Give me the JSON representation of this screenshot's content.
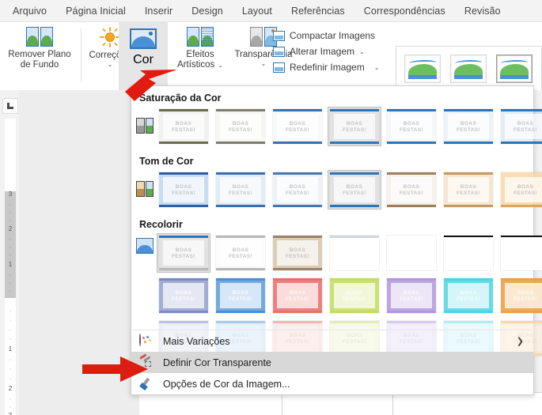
{
  "ribbon": {
    "tabs": [
      {
        "label": "Arquivo"
      },
      {
        "label": "Página Inicial"
      },
      {
        "label": "Inserir"
      },
      {
        "label": "Design"
      },
      {
        "label": "Layout"
      },
      {
        "label": "Referências"
      },
      {
        "label": "Correspondências"
      },
      {
        "label": "Revisão"
      }
    ],
    "groups": {
      "remove_background": {
        "label_line1": "Remover Plano",
        "label_line2": "de Fundo"
      },
      "corrections": {
        "label": "Correções",
        "chevron": "⌄"
      },
      "color": {
        "label": "Cor",
        "chevron": "⌄"
      },
      "artistic_effects": {
        "label_line1": "Efeitos",
        "label_line2": "Artísticos",
        "chevron": "⌄"
      },
      "transparency": {
        "label": "Transparência",
        "chevron": "⌄"
      }
    },
    "commands": [
      {
        "label": "Compactar Imagens",
        "chevron": ""
      },
      {
        "label": "Alterar Imagem",
        "chevron": "⌄"
      },
      {
        "label": "Redefinir Imagem",
        "chevron": "⌄"
      }
    ]
  },
  "menu": {
    "sections": [
      {
        "title": "Saturação da Cor",
        "selected_index": 3,
        "thumbs": [
          {
            "top": "#6b6b52",
            "bottom": "#6b6b52",
            "tint": "rgba(120,120,110,0.10)"
          },
          {
            "top": "#7d7d6a",
            "bottom": "#7d7d6a",
            "tint": "rgba(130,130,120,0.07)"
          },
          {
            "top": "#3f6fa8",
            "bottom": "#3f6fa8",
            "tint": "rgba(110,140,175,0.06)"
          },
          {
            "top": "#2e75b6",
            "bottom": "#2e75b6",
            "tint": "rgba(255,255,255,0)"
          },
          {
            "top": "#2e75b6",
            "bottom": "#2e75b6",
            "tint": "rgba(46,117,182,0.05)"
          },
          {
            "top": "#2e75b6",
            "bottom": "#2e75b6",
            "tint": "rgba(46,117,182,0.09)"
          },
          {
            "top": "#2e75b6",
            "bottom": "#2e75b6",
            "tint": "rgba(46,117,182,0.13)"
          }
        ]
      },
      {
        "title": "Tom de Cor",
        "selected_index": 3,
        "thumbs": [
          {
            "top": "#2e5fa8",
            "bottom": "#2e5fa8",
            "tint": "rgba(154,193,232,0.55)"
          },
          {
            "top": "#3a6fb0",
            "bottom": "#3a6fb0",
            "tint": "rgba(179,208,237,0.40)"
          },
          {
            "top": "#4a76ae",
            "bottom": "#4a76ae",
            "tint": "rgba(200,213,229,0.30)"
          },
          {
            "top": "#2e75b6",
            "bottom": "#2e75b6",
            "tint": "rgba(255,255,255,0)"
          },
          {
            "top": "#9b7f5e",
            "bottom": "#9b7f5e",
            "tint": "rgba(232,219,203,0.40)"
          },
          {
            "top": "#c39a62",
            "bottom": "#c39a62",
            "tint": "rgba(240,214,177,0.60)"
          },
          {
            "top": "#d9a košik",
            "bottom": "#d9a85c",
            "tint": "rgba(246,211,160,0.78)"
          }
        ]
      },
      {
        "title": "Recolorir",
        "selected_index": 0,
        "rows": [
          [
            {
              "top": "#2e75b6",
              "bottom": "#b9b9b9",
              "tint": "rgba(255,255,255,0)",
              "label": "none"
            },
            {
              "top": "#b8b8b8",
              "bottom": "#b8b8b8",
              "tint": "rgba(250,250,250,0.55)",
              "label": "grayscale"
            },
            {
              "top": "#9b8467",
              "bottom": "#9b8467",
              "tint": "rgba(214,196,169,0.85)",
              "label": "sepia"
            },
            {
              "top": "#cfd8e0",
              "bottom": "#ffffff",
              "tint": "rgba(255,255,255,0.92)",
              "label": "washout"
            },
            {
              "top": "#ffffff",
              "bottom": "#ffffff",
              "tint": "rgba(255,255,255,1)",
              "label": "blank"
            },
            {
              "top": "#111111",
              "bottom": "#ffffff",
              "tint": "rgba(255,255,255,0.98)",
              "label": "black-white"
            },
            {
              "top": "#111111",
              "bottom": "#ffffff",
              "tint": "rgba(255,255,255,0.98)",
              "label": "black-white-2"
            }
          ],
          [
            {
              "top": "#7b8cc4",
              "bottom": "#7b8cc4",
              "tint": "rgba(140,155,200,0.82)",
              "label": "blue-gray"
            },
            {
              "top": "#4a90d9",
              "bottom": "#4a90d9",
              "tint": "rgba(92,155,219,0.85)",
              "label": "blue"
            },
            {
              "top": "#e8716d",
              "bottom": "#e8716d",
              "tint": "rgba(232,113,109,0.88)",
              "label": "red"
            },
            {
              "top": "#c4dc62",
              "bottom": "#c4dc62",
              "tint": "rgba(196,220,98,0.88)",
              "label": "olive"
            },
            {
              "top": "#b197dd",
              "bottom": "#b197dd",
              "tint": "rgba(177,151,221,0.85)",
              "label": "purple"
            },
            {
              "top": "#4fd4e4",
              "bottom": "#4fd4e4",
              "tint": "rgba(79,212,228,0.85)",
              "label": "aqua"
            },
            {
              "top": "#eba247",
              "bottom": "#eba247",
              "tint": "rgba(235,162,71,0.90)",
              "label": "orange"
            }
          ],
          [
            {
              "top": "#b9c2e0",
              "bottom": "#b9c2e0",
              "tint": "rgba(215,220,238,0.45)",
              "label": "blue-gray-light"
            },
            {
              "top": "#a6cbec",
              "bottom": "#a6cbec",
              "tint": "rgba(198,225,245,0.45)",
              "label": "blue-light"
            },
            {
              "top": "#f3b8b6",
              "bottom": "#f3b8b6",
              "tint": "rgba(247,208,206,0.45)",
              "label": "red-light"
            },
            {
              "top": "#e4eeb4",
              "bottom": "#e4eeb4",
              "tint": "rgba(234,242,197,0.45)",
              "label": "olive-light"
            },
            {
              "top": "#d8cbef",
              "bottom": "#d8cbef",
              "tint": "rgba(224,214,243,0.45)",
              "label": "purple-light"
            },
            {
              "top": "#b2ecf2",
              "bottom": "#b2ecf2",
              "tint": "rgba(200,240,246,0.45)",
              "label": "aqua-light"
            },
            {
              "top": "#f7d8ac",
              "bottom": "#f7d8ac",
              "tint": "rgba(250,226,190,0.45)",
              "label": "orange-light"
            }
          ]
        ]
      }
    ],
    "thumb_caption": {
      "line1": "BOAS",
      "line2": "FESTAS!"
    },
    "items": [
      {
        "label": "Mais Variações",
        "icon": "palette-icon",
        "has_submenu": true,
        "highlighted": false,
        "submenu_arrow": "❯"
      },
      {
        "label": "Definir Cor Transparente",
        "icon": "transparent-pen-icon",
        "has_submenu": false,
        "highlighted": true,
        "submenu_arrow": ""
      },
      {
        "label": "Opções de Cor da Imagem...",
        "icon": "picture-color-options-icon",
        "has_submenu": false,
        "highlighted": false,
        "submenu_arrow": ""
      }
    ]
  },
  "ruler": {
    "tab_marker": "L",
    "gray_numbers": [
      "3",
      "2",
      "1"
    ],
    "white_numbers": [
      "1",
      "2",
      "3"
    ]
  },
  "annotations": {
    "arrow_color": "#e01b10",
    "arrow_to_color_dropdown": "points-up-right-at-cor-dropdown",
    "arrow_to_transparent_item": "points-right-at-definir-cor-transparente"
  }
}
